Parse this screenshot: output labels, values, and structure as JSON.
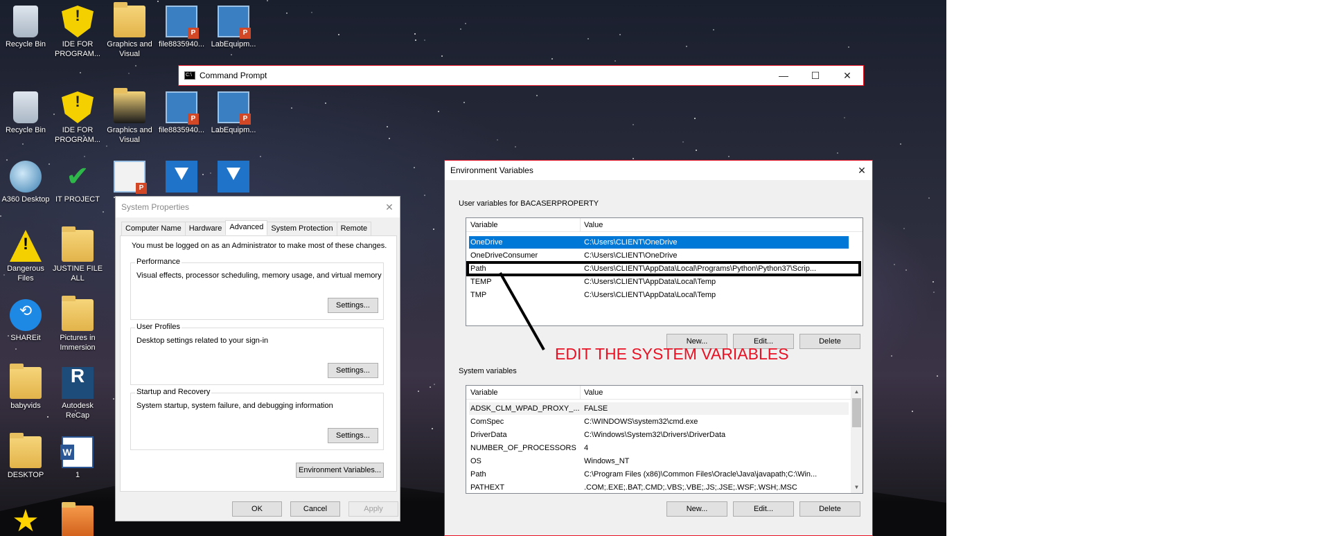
{
  "desktop": {
    "icons": [
      {
        "label": "Recycle Bin",
        "icon": "recycle-bin-icon"
      },
      {
        "label": "IDE FOR PROGRAM...",
        "icon": "shield-icon"
      },
      {
        "label": "Graphics and Visual",
        "icon": "folder-icon"
      },
      {
        "label": "file8835940...",
        "icon": "powerpoint-icon"
      },
      {
        "label": "LabEquipm...",
        "icon": "powerpoint-icon"
      },
      {
        "label": "Recycle Bin",
        "icon": "recycle-bin-icon"
      },
      {
        "label": "IDE FOR PROGRAM...",
        "icon": "shield-icon"
      },
      {
        "label": "Graphics and Visual",
        "icon": "folder-icon"
      },
      {
        "label": "file8835940...",
        "icon": "powerpoint-icon"
      },
      {
        "label": "LabEquipm...",
        "icon": "powerpoint-icon"
      },
      {
        "label": "A360 Desktop",
        "icon": "a360-icon"
      },
      {
        "label": "IT PROJECT",
        "icon": "checkmark-icon"
      },
      {
        "label": "3_",
        "icon": "powerpoint-icon"
      },
      {
        "label": "",
        "icon": "download-arrow-icon"
      },
      {
        "label": "",
        "icon": "download-arrow-icon"
      },
      {
        "label": "Dangerous Files",
        "icon": "warning-icon"
      },
      {
        "label": "JUSTINE FILE ALL",
        "icon": "folder-icon"
      },
      {
        "label": "SHAREit",
        "icon": "shareit-icon"
      },
      {
        "label": "Pictures in Immersion",
        "icon": "folder-icon"
      },
      {
        "label": "babyvids",
        "icon": "folder-icon"
      },
      {
        "label": "Autodesk ReCap",
        "icon": "recap-icon"
      },
      {
        "label": "DESKTOP",
        "icon": "folder-icon"
      },
      {
        "label": "1",
        "icon": "word-icon"
      },
      {
        "label": "",
        "icon": "star-icon"
      },
      {
        "label": "",
        "icon": "folder-icon"
      }
    ]
  },
  "cmd": {
    "title": "Command Prompt",
    "icon_text": "C:\\",
    "minimize": "—",
    "maximize": "☐",
    "close": "✕"
  },
  "sysprops": {
    "title": "System Properties",
    "close": "✕",
    "tabs": [
      "Computer Name",
      "Hardware",
      "Advanced",
      "System Protection",
      "Remote"
    ],
    "active_tab": "Advanced",
    "admin_note": "You must be logged on as an Administrator to make most of these changes.",
    "performance": {
      "title": "Performance",
      "desc": "Visual effects, processor scheduling, memory usage, and virtual memory",
      "button": "Settings..."
    },
    "profiles": {
      "title": "User Profiles",
      "desc": "Desktop settings related to your sign-in",
      "button": "Settings..."
    },
    "startup": {
      "title": "Startup and Recovery",
      "desc": "System startup, system failure, and debugging information",
      "button": "Settings..."
    },
    "env_button": "Environment Variables...",
    "ok": "OK",
    "cancel": "Cancel",
    "apply": "Apply"
  },
  "envvars": {
    "title": "Environment Variables",
    "close": "✕",
    "user_label": "User variables for BACASERPROPERTY",
    "col_variable": "Variable",
    "col_value": "Value",
    "user_rows": [
      {
        "name": "OneDrive",
        "value": "C:\\Users\\CLIENT\\OneDrive"
      },
      {
        "name": "OneDriveConsumer",
        "value": "C:\\Users\\CLIENT\\OneDrive"
      },
      {
        "name": "Path",
        "value": "C:\\Users\\CLIENT\\AppData\\Local\\Programs\\Python\\Python37\\Scrip..."
      },
      {
        "name": "TEMP",
        "value": "C:\\Users\\CLIENT\\AppData\\Local\\Temp"
      },
      {
        "name": "TMP",
        "value": "C:\\Users\\CLIENT\\AppData\\Local\\Temp"
      }
    ],
    "user_new": "New...",
    "user_edit": "Edit...",
    "user_delete": "Delete",
    "system_label": "System variables",
    "system_rows": [
      {
        "name": "ADSK_CLM_WPAD_PROXY_...",
        "value": "FALSE"
      },
      {
        "name": "ComSpec",
        "value": "C:\\WINDOWS\\system32\\cmd.exe"
      },
      {
        "name": "DriverData",
        "value": "C:\\Windows\\System32\\Drivers\\DriverData"
      },
      {
        "name": "NUMBER_OF_PROCESSORS",
        "value": "4"
      },
      {
        "name": "OS",
        "value": "Windows_NT"
      },
      {
        "name": "Path",
        "value": "C:\\Program Files (x86)\\Common Files\\Oracle\\Java\\javapath;C:\\Win..."
      },
      {
        "name": "PATHEXT",
        "value": ".COM;.EXE;.BAT;.CMD;.VBS;.VBE;.JS;.JSE;.WSF;.WSH;.MSC"
      }
    ],
    "sys_new": "New...",
    "sys_edit": "Edit...",
    "sys_delete": "Delete",
    "scroll_up": "▲",
    "scroll_down": "▼"
  },
  "annotation": {
    "text": "EDIT THE SYSTEM VARIABLES",
    "color": "#e81123"
  }
}
